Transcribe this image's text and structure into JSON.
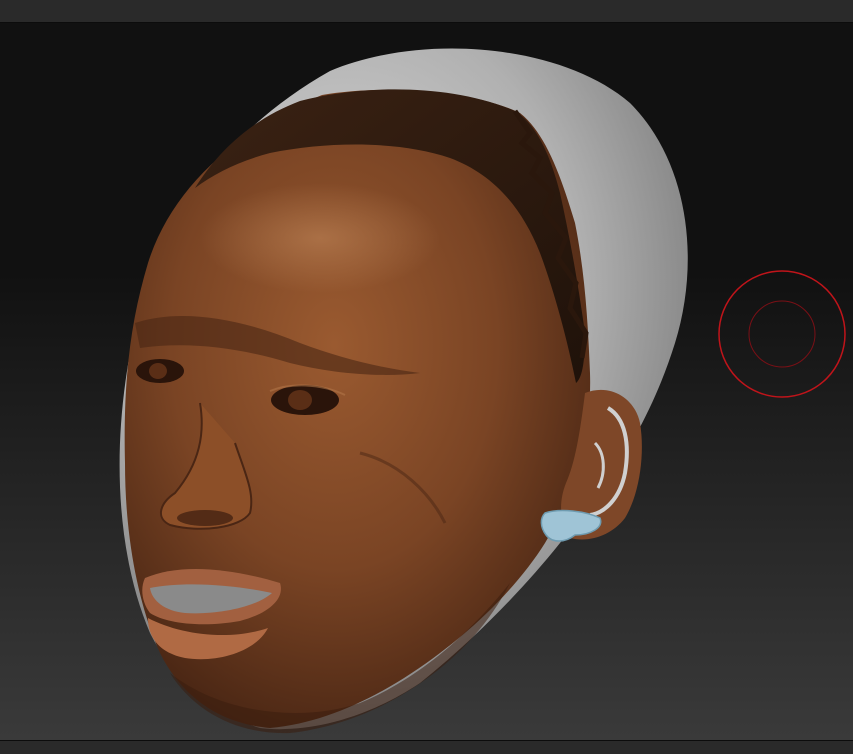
{
  "viewport": {
    "background_top_color": "#111111",
    "background_bottom_color": "#3a3a3a",
    "toolbar_color": "#2a2a2a"
  },
  "model": {
    "skin_color": "#7a4424",
    "clay_color": "#b8b8b8",
    "hair_color": "#2e1a0e",
    "earring_color": "#9fc4d6"
  },
  "brush_cursor": {
    "outer_color": "#c0141a",
    "inner_color": "#7a1016"
  }
}
